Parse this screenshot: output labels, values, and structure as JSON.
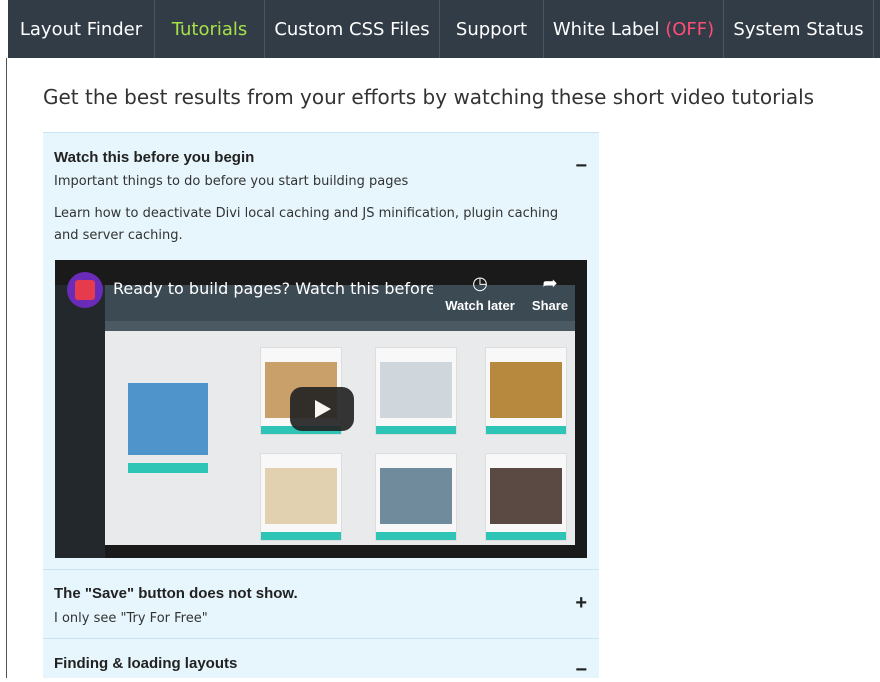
{
  "nav": {
    "tabs": [
      {
        "label": "Layout Finder"
      },
      {
        "label": "Tutorials"
      },
      {
        "label": "Custom CSS Files"
      },
      {
        "label": "Support"
      },
      {
        "label": "White Label",
        "status": "(OFF)"
      },
      {
        "label": "System Status"
      }
    ],
    "active_tab": "Tutorials"
  },
  "intro": "Get the best results from your efforts by watching these short video tutorials",
  "accordion": [
    {
      "title": "Watch this before you begin",
      "subtitle": "Important things to do before you start building pages",
      "description": "Learn how to deactivate Divi local caching and JS minification, plugin caching and server caching.",
      "toggle": "−",
      "video": {
        "title": "Ready to build pages? Watch this before ...",
        "watch_later": "Watch later",
        "share": "Share",
        "watch_later_icon": "clock-icon",
        "share_icon": "share-icon"
      }
    },
    {
      "title": "The \"Save\" button does not show.",
      "subtitle": "I only see \"Try For Free\"",
      "toggle": "+"
    },
    {
      "title": "Finding & loading layouts",
      "toggle": "−"
    }
  ],
  "colors": {
    "nav_bg": "#313c46",
    "active_tab": "#a8e04a",
    "off_label": "#ff4d78",
    "accordion_bg": "#e6f6fc"
  }
}
